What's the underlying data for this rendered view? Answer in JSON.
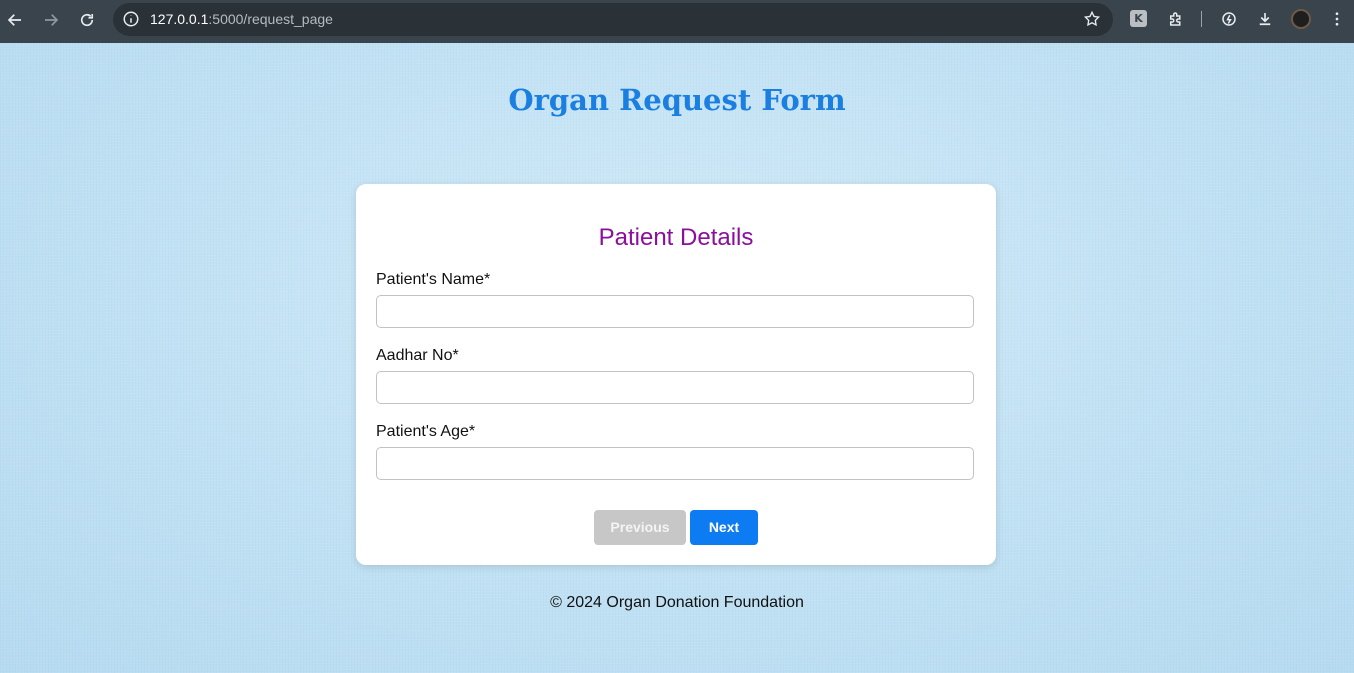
{
  "browser": {
    "url_host": "127.0.0.1",
    "url_path": ":5000/request_page",
    "icons": [
      "back-icon",
      "forward-icon",
      "reload-icon",
      "info-icon",
      "star-icon",
      "extension-k-icon",
      "puzzle-icon",
      "speed-icon",
      "download-icon",
      "avatar",
      "menu-icon"
    ]
  },
  "page": {
    "title": "Organ Request Form",
    "section_title": "Patient Details",
    "fields": [
      {
        "label": "Patient's Name*",
        "value": "",
        "placeholder": ""
      },
      {
        "label": "Aadhar No*",
        "value": "",
        "placeholder": ""
      },
      {
        "label": "Patient's Age*",
        "value": "",
        "placeholder": ""
      }
    ],
    "buttons": {
      "previous": "Previous",
      "next": "Next"
    },
    "footer": "© 2024 Organ Donation Foundation"
  },
  "colors": {
    "title": "#1a7fe0",
    "section_title": "#8b0f9c",
    "next_button": "#0d7bf2",
    "previous_button": "#c7c7c7"
  }
}
